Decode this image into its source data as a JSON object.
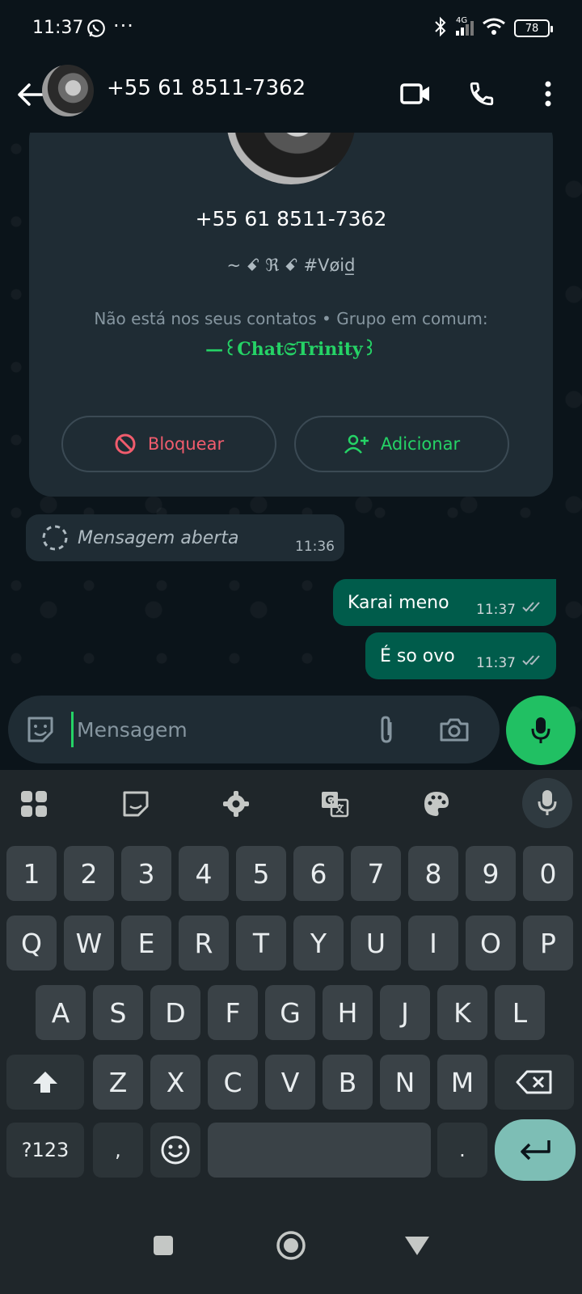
{
  "status_bar": {
    "time": "11:37",
    "more": "···",
    "network": "4G",
    "battery": "78"
  },
  "app_bar": {
    "title": "+55 61 8511-7362"
  },
  "profile_card": {
    "phone": "+55 61 8511-7362",
    "about": "~ ꗃ ℜ ꗃ #Vøid̲",
    "note": "Não está nos seus contatos • Grupo em comum:",
    "group_name": "—꒰Chat𝔖Trinity꒱",
    "block_label": "Bloquear",
    "add_label": "Adicionar"
  },
  "messages": [
    {
      "direction": "in",
      "text": "Mensagem aberta",
      "time": "11:36"
    },
    {
      "direction": "out",
      "text": "Karai meno",
      "time": "11:37"
    },
    {
      "direction": "out",
      "text": "É so ovo",
      "time": "11:37"
    }
  ],
  "composer": {
    "placeholder": "Mensagem"
  },
  "keyboard": {
    "row_numbers": [
      "1",
      "2",
      "3",
      "4",
      "5",
      "6",
      "7",
      "8",
      "9",
      "0"
    ],
    "row1": [
      "Q",
      "W",
      "E",
      "R",
      "T",
      "Y",
      "U",
      "I",
      "O",
      "P"
    ],
    "row2": [
      "A",
      "S",
      "D",
      "F",
      "G",
      "H",
      "J",
      "K",
      "L"
    ],
    "row3": [
      "Z",
      "X",
      "C",
      "V",
      "B",
      "N",
      "M"
    ],
    "symbols_key": "?123",
    "comma_key": ",",
    "period_key": "."
  },
  "colors": {
    "accent": "#25d366",
    "bubble_out": "#005c4b",
    "danger": "#f15c6d",
    "background": "#0b141a"
  }
}
